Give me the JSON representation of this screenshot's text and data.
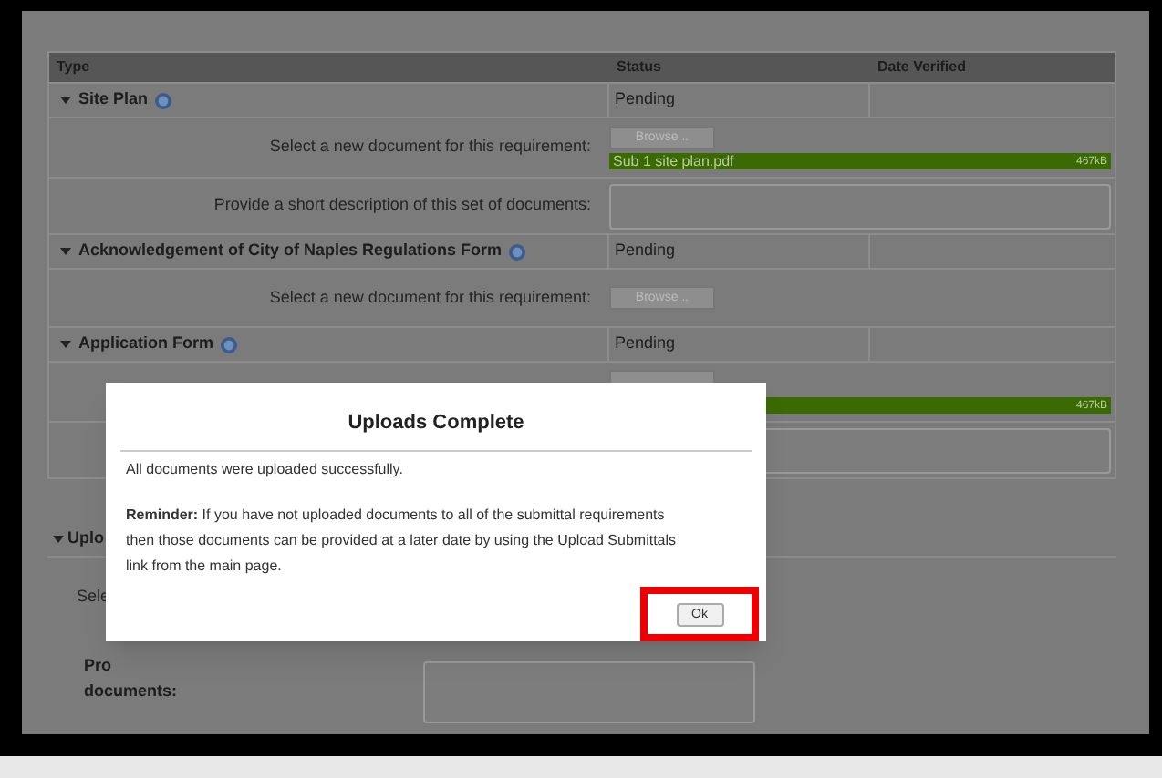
{
  "table": {
    "columns": [
      "Type",
      "Status",
      "Date Verified"
    ],
    "requirements": [
      {
        "name": "Site Plan",
        "status": "Pending",
        "details": [
          {
            "kind": "file",
            "label": "Select a new document for this requirement:",
            "button": "Browse...",
            "file": {
              "name": "Sub 1 site plan.pdf",
              "size": "467kB",
              "level": 1
            }
          },
          {
            "kind": "text",
            "label": "Provide a short description of this set of documents:"
          }
        ]
      },
      {
        "name": "Acknowledgement of City of Naples Regulations Form",
        "status": "Pending",
        "details": [
          {
            "kind": "file",
            "label": "Select a new document for this requirement:",
            "button": "Browse..."
          }
        ]
      },
      {
        "name": "Application Form",
        "status": "Pending",
        "details": [
          {
            "kind": "file",
            "file": {
              "size": "467kB",
              "level": 1
            }
          },
          {
            "kind": "text"
          }
        ]
      }
    ]
  },
  "upload_section": {
    "title": "Uplo",
    "select_label": "Sele",
    "description_label": [
      "Pro",
      "documents:"
    ]
  },
  "dialog": {
    "title": "Uploads Complete",
    "message": "All documents were uploaded successfully.",
    "reminder": "**Reminder:** If you have not uploaded documents to all of the submittal requirements then those documents can be provided at a later date by using the Upload Submittals link from the main page.",
    "button": "Ok",
    "button_highlighted": true
  }
}
